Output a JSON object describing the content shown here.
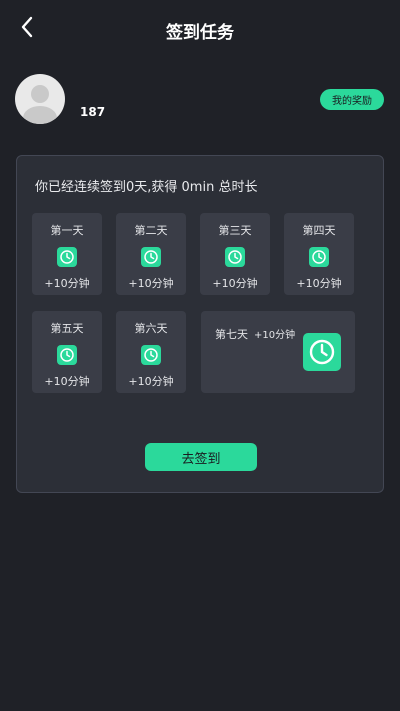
{
  "header": {
    "title": "签到任务"
  },
  "user": {
    "name": "187"
  },
  "reward_button": {
    "label": "我的奖励"
  },
  "summary": "你已经连续签到0天,获得 0min 总时长",
  "days": [
    {
      "label": "第一天",
      "reward": "+10分钟"
    },
    {
      "label": "第二天",
      "reward": "+10分钟"
    },
    {
      "label": "第三天",
      "reward": "+10分钟"
    },
    {
      "label": "第四天",
      "reward": "+10分钟"
    },
    {
      "label": "第五天",
      "reward": "+10分钟"
    },
    {
      "label": "第六天",
      "reward": "+10分钟"
    },
    {
      "label": "第七天",
      "reward": "+10分钟"
    }
  ],
  "sign_button": {
    "label": "去签到"
  },
  "colors": {
    "accent": "#2bd99b",
    "background": "#1f2127",
    "card": "#2c2f37",
    "tile": "#3a3d47"
  }
}
